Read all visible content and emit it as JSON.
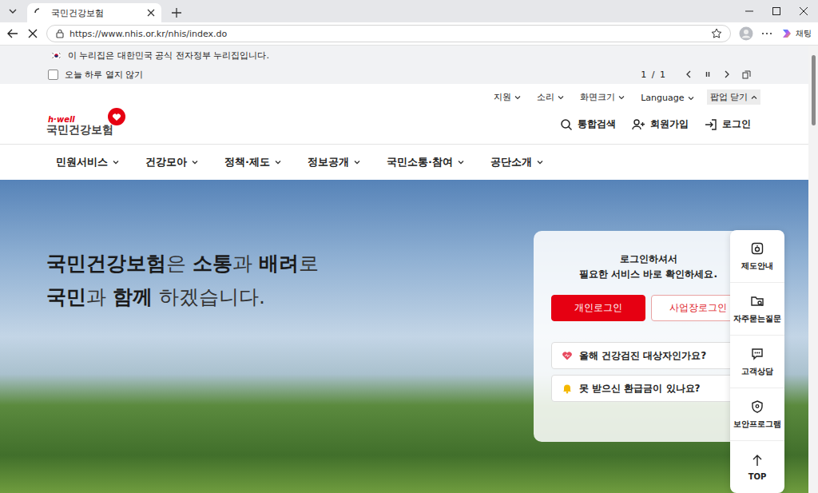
{
  "browser": {
    "tab": {
      "title": "국민건강보험",
      "loading": true
    },
    "url": "https://www.nhis.or.kr/nhis/index.do",
    "copilot": "채팅"
  },
  "gov_banner": {
    "text": "이 누리집은 대한민국 공식 전자정부 누리집입니다.",
    "checkbox": {
      "label": "오늘 하루 열지 않기",
      "checked": false
    },
    "pager": "1 / 1"
  },
  "utility": [
    {
      "label": "지원",
      "expanded": false
    },
    {
      "label": "소리",
      "expanded": false
    },
    {
      "label": "화면크기",
      "expanded": false
    },
    {
      "label": "Language",
      "expanded": false
    },
    {
      "label": "팝업 닫기",
      "expanded": true
    }
  ],
  "logo": {
    "tagline": "h·well",
    "name": "국민건강보험"
  },
  "header_actions": [
    {
      "label": "통합검색",
      "kind": "search"
    },
    {
      "label": "회원가입",
      "kind": "join"
    },
    {
      "label": "로그인",
      "kind": "login"
    }
  ],
  "nav": [
    "민원서비스",
    "건강모아",
    "정책·제도",
    "정보공개",
    "국민소통·참여",
    "공단소개"
  ],
  "hero": {
    "lines": [
      [
        {
          "text": "국민건강보험",
          "bold": true
        },
        {
          "text": "은 ",
          "bold": false
        },
        {
          "text": "소통",
          "bold": true
        },
        {
          "text": "과 ",
          "bold": false
        },
        {
          "text": "배려",
          "bold": true
        },
        {
          "text": "로",
          "bold": false
        }
      ],
      [
        {
          "text": "국민",
          "bold": true
        },
        {
          "text": "과 ",
          "bold": false
        },
        {
          "text": "함께",
          "bold": true
        },
        {
          "text": " 하겠습니다.",
          "bold": false
        }
      ]
    ]
  },
  "login_card": {
    "message": [
      "로그인하셔서",
      "필요한 서비스 바로 확인하세요."
    ],
    "buttons": [
      {
        "label": "개인로그인",
        "primary": true
      },
      {
        "label": "사업장로그인",
        "primary": false
      }
    ],
    "links": [
      {
        "label": "올해 건강검진 대상자인가요?",
        "kind": "checkup"
      },
      {
        "label": "못 받으신 환급금이 있나요?",
        "kind": "refund"
      }
    ]
  },
  "quick_menu": [
    {
      "label": "제도안내",
      "kind": "guide"
    },
    {
      "label": "자주묻는질문",
      "kind": "faq"
    },
    {
      "label": "고객상담",
      "kind": "consult"
    },
    {
      "label": "보안프로그램",
      "kind": "security"
    },
    {
      "label": "TOP",
      "kind": "top"
    }
  ],
  "scrollbar": {
    "level": 0.16
  }
}
